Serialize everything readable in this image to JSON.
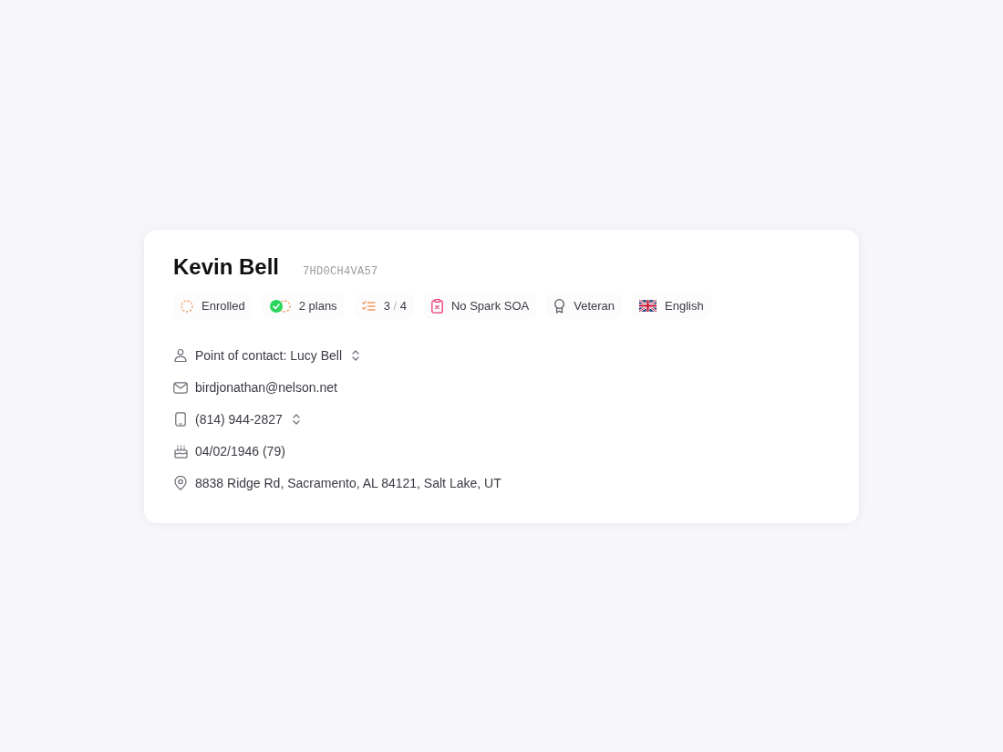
{
  "card": {
    "name": "Kevin Bell",
    "id_code": "7HD0CH4VA57",
    "badges": [
      {
        "kind": "status",
        "label": "Enrolled"
      },
      {
        "kind": "plans",
        "label": "2 plans"
      },
      {
        "kind": "progress",
        "value": "3",
        "separator": "/",
        "total": "4"
      },
      {
        "kind": "soa",
        "label": "No Spark SOA"
      },
      {
        "kind": "veteran",
        "label": "Veteran"
      },
      {
        "kind": "language",
        "label": "English"
      }
    ],
    "details": [
      {
        "kind": "contact",
        "text": "Point of contact: Lucy Bell",
        "dropdown": true
      },
      {
        "kind": "email",
        "text": "birdjonathan@nelson.net",
        "dropdown": false
      },
      {
        "kind": "phone",
        "text": "(814) 944-2827",
        "dropdown": true
      },
      {
        "kind": "birthday",
        "text": "04/02/1946 (79)",
        "dropdown": false
      },
      {
        "kind": "address",
        "text": "8838 Ridge Rd, Sacramento, AL 84121, Salt Lake, UT",
        "dropdown": false
      }
    ]
  }
}
